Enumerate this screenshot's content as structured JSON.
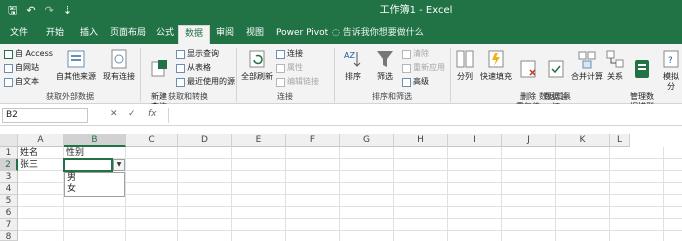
{
  "window": {
    "title": "工作簿1 - Excel"
  },
  "quick_access": {
    "save_glyph": "🖫",
    "undo_glyph": "↶",
    "redo_glyph": "↷",
    "more_glyph": "⇣"
  },
  "tabs": [
    {
      "label": "文件"
    },
    {
      "label": "开始"
    },
    {
      "label": "插入"
    },
    {
      "label": "页面布局"
    },
    {
      "label": "公式"
    },
    {
      "label": "数据",
      "active": true
    },
    {
      "label": "审阅"
    },
    {
      "label": "视图"
    },
    {
      "label": "Power Pivot"
    }
  ],
  "tell_me": "告诉我你想要做什么",
  "ribbon": {
    "get_external": {
      "label": "获取外部数据",
      "access": "自 Access",
      "web": "自网站",
      "text": "自文本",
      "other": "自其他来源",
      "existing": "现有连接"
    },
    "get_transform": {
      "label": "获取和转换",
      "new_query": "新建\n查询",
      "show_queries": "显示查询",
      "from_table": "从表格",
      "recent": "最近使用的源"
    },
    "connections": {
      "label": "连接",
      "refresh_all": "全部刷新",
      "connections": "连接",
      "properties": "属性",
      "edit_links": "编辑链接"
    },
    "sort_filter": {
      "label": "排序和筛选",
      "sort": "排序",
      "filter": "筛选",
      "clear": "清除",
      "reapply": "重新应用",
      "advanced": "高级"
    },
    "data_tools": {
      "label": "数据工具",
      "split": "分列",
      "flash_fill": "快速填充",
      "remove_dup": "删除\n重复值",
      "validation": "数据验\n证",
      "consolidate": "合并计算",
      "relationships": "关系",
      "data_model": "管理数\n据模型",
      "whatif": "模拟分"
    }
  },
  "formula_bar": {
    "name_box": "B2",
    "cancel": "✕",
    "enter": "✓",
    "fx": "fx",
    "formula": ""
  },
  "columns": [
    "A",
    "B",
    "C",
    "D",
    "E",
    "F",
    "G",
    "H",
    "I",
    "J",
    "K",
    "L",
    "M",
    "N"
  ],
  "rows": [
    "1",
    "2",
    "3",
    "4",
    "5",
    "6",
    "7",
    "8"
  ],
  "cells": {
    "A1": "姓名",
    "B1": "性别",
    "A2": "张三"
  },
  "active_cell": "B2",
  "dropdown": {
    "arrow": "▼",
    "options": [
      "男",
      "女"
    ]
  }
}
